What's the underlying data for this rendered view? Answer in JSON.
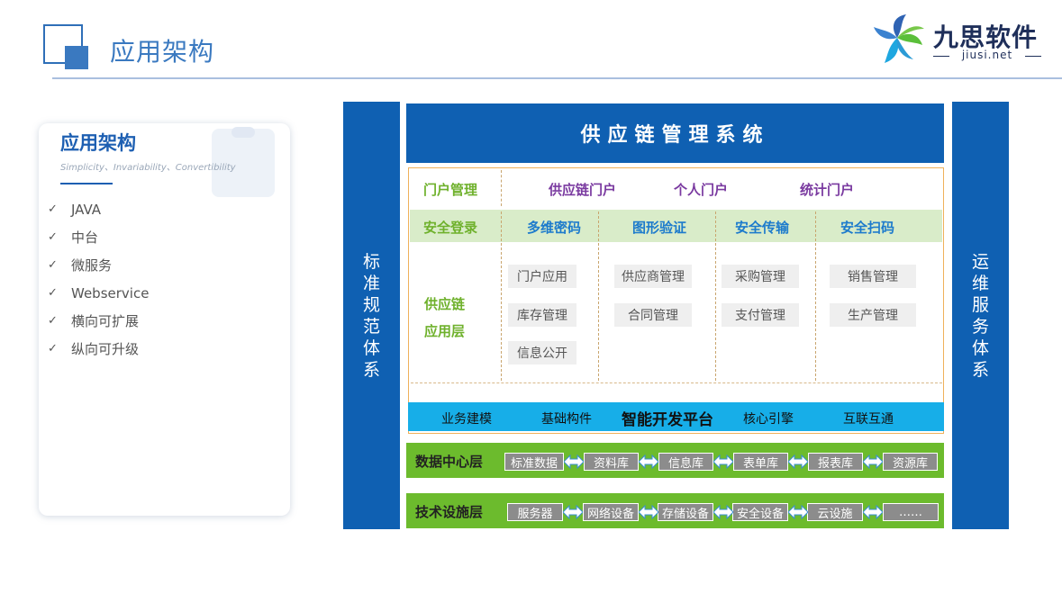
{
  "header": {
    "title": "应用架构",
    "brand_name": "九思软件",
    "brand_url": "jiusi.net"
  },
  "card": {
    "title": "应用架构",
    "subtitle": "Simplicity、Invariability、Convertibility",
    "tick": "✓",
    "items": [
      "JAVA",
      "中台",
      "微服务",
      "Webservice",
      "横向可扩展",
      "纵向可升级"
    ]
  },
  "diagram": {
    "left_side": [
      "标",
      "准",
      "规",
      "范",
      "体",
      "系"
    ],
    "right_side": [
      "运",
      "维",
      "服",
      "务",
      "体",
      "系"
    ],
    "top_title": "供应链管理系统",
    "portal": {
      "label": "门户管理",
      "items": [
        "供应链门户",
        "个人门户",
        "统计门户"
      ]
    },
    "security": {
      "label": "安全登录",
      "items": [
        "多维密码",
        "图形验证",
        "安全传输",
        "安全扫码"
      ]
    },
    "app_layer": {
      "label_line1": "供应链",
      "label_line2": "应用层",
      "col1": [
        "门户应用",
        "库存管理",
        "信息公开"
      ],
      "col2": [
        "供应商管理",
        "合同管理"
      ],
      "col3": [
        "采购管理",
        "支付管理"
      ],
      "col4": [
        "销售管理",
        "生产管理"
      ]
    },
    "platform": {
      "items_left": [
        "业务建模",
        "基础构件"
      ],
      "center": "智能开发平台",
      "items_right": [
        "核心引擎",
        "互联互通"
      ]
    },
    "data_layer": {
      "label": "数据中心层",
      "items": [
        "标准数据",
        "资料库",
        "信息库",
        "表单库",
        "报表库",
        "资源库"
      ]
    },
    "tech_layer": {
      "label": "技术设施层",
      "items": [
        "服务器",
        "网络设备",
        "存储设备",
        "安全设备",
        "云设施",
        "……"
      ]
    }
  },
  "colors": {
    "primary_blue": "#0f60b2",
    "accent_green": "#6cbb2d",
    "platform_cyan": "#17aee8",
    "security_green_text": "#6fb12c",
    "portal_purple_text": "#7a3aa0"
  }
}
